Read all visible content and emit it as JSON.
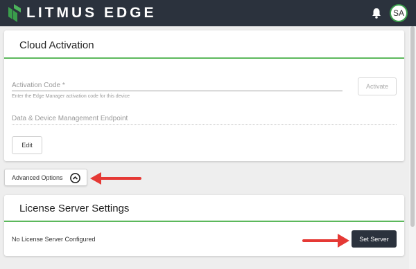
{
  "header": {
    "brand": "LITMUS EDGE",
    "avatar_initials": "SA",
    "bell_icon": "bell-icon",
    "accent_color": "#3a9e4b",
    "bar_color": "#2b323d"
  },
  "cloud_activation": {
    "title": "Cloud Activation",
    "activation_code_label": "Activation Code *",
    "activation_code_value": "",
    "activation_code_helper": "Enter the Edge Manager activation code for this device",
    "activate_button": "Activate",
    "endpoint_label": "Data & Device Management Endpoint",
    "endpoint_value": "",
    "edit_button": "Edit"
  },
  "advanced_options": {
    "label": "Advanced Options",
    "icon": "chevron-up-circle-icon",
    "expanded": true
  },
  "license_server": {
    "title": "License Server Settings",
    "status_text": "No License Server Configured",
    "set_server_button": "Set Server"
  },
  "annotations": {
    "arrow_color": "#e53935"
  }
}
